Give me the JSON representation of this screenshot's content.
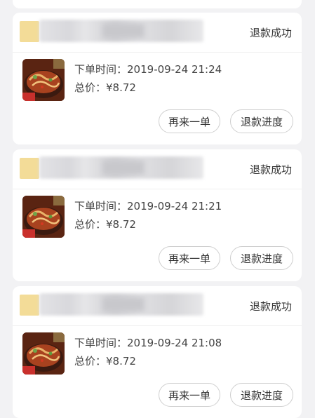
{
  "orders": [
    {
      "store_name": "",
      "status": "退款成功",
      "time_label": "下单时间：",
      "time_value": "2019-09-24 21:24",
      "price_label": "总价：",
      "price_value": "¥8.72",
      "reorder_label": "再来一单",
      "refund_progress_label": "退款进度"
    },
    {
      "store_name": "",
      "status": "退款成功",
      "time_label": "下单时间：",
      "time_value": "2019-09-24 21:21",
      "price_label": "总价：",
      "price_value": "¥8.72",
      "reorder_label": "再来一单",
      "refund_progress_label": "退款进度"
    },
    {
      "store_name": "",
      "status": "退款成功",
      "time_label": "下单时间：",
      "time_value": "2019-09-24 21:08",
      "price_label": "总价：",
      "price_value": "¥8.72",
      "reorder_label": "再来一单",
      "refund_progress_label": "退款进度"
    }
  ],
  "colors": {
    "background": "#f2f2f4",
    "card": "#ffffff",
    "store_logo": "#f3dc98",
    "text": "#333333",
    "button_border": "#cfcfcf"
  }
}
